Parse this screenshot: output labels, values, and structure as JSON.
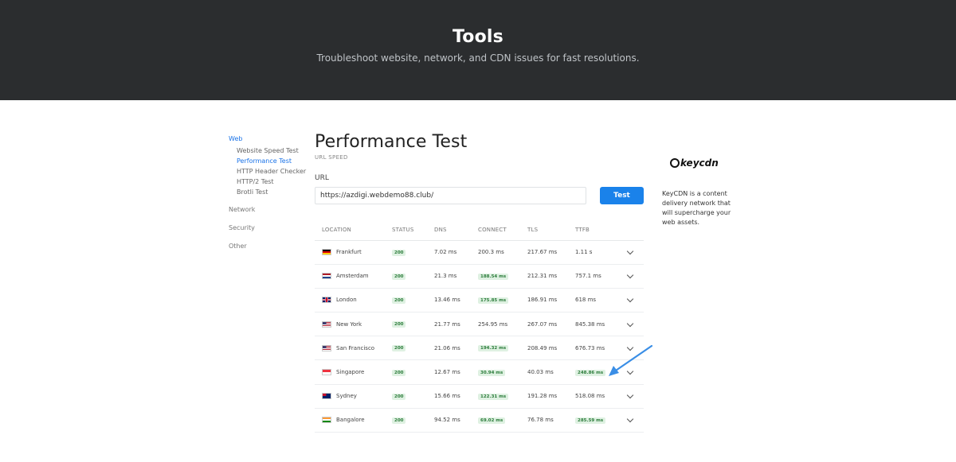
{
  "hero": {
    "title": "Tools",
    "subtitle": "Troubleshoot website, network, and CDN issues for fast resolutions."
  },
  "sidenav": {
    "web_label": "Web",
    "web_items": [
      {
        "label": "Website Speed Test",
        "active": false
      },
      {
        "label": "Performance Test",
        "active": true
      },
      {
        "label": "HTTP Header Checker",
        "active": false
      },
      {
        "label": "HTTP/2 Test",
        "active": false
      },
      {
        "label": "Brotli Test",
        "active": false
      }
    ],
    "network_label": "Network",
    "security_label": "Security",
    "other_label": "Other"
  },
  "main": {
    "title": "Performance Test",
    "subtitle": "URL SPEED",
    "url_label": "URL",
    "url_value": "https://azdigi.webdemo88.club/",
    "test_button": "Test"
  },
  "table": {
    "headers": [
      "LOCATION",
      "STATUS",
      "DNS",
      "CONNECT",
      "TLS",
      "TTFB"
    ],
    "rows": [
      {
        "location": "Frankfurt",
        "flag": "de",
        "status": "200",
        "dns": "7.02 ms",
        "connect": "200.3 ms",
        "connect_badge": false,
        "tls": "217.67 ms",
        "ttfb": "1.11 s",
        "ttfb_badge": false
      },
      {
        "location": "Amsterdam",
        "flag": "nl",
        "status": "200",
        "dns": "21.3 ms",
        "connect": "188.54 ms",
        "connect_badge": true,
        "tls": "212.31 ms",
        "ttfb": "757.1 ms",
        "ttfb_badge": false
      },
      {
        "location": "London",
        "flag": "gb",
        "status": "200",
        "dns": "13.46 ms",
        "connect": "175.85 ms",
        "connect_badge": true,
        "tls": "186.91 ms",
        "ttfb": "618 ms",
        "ttfb_badge": false
      },
      {
        "location": "New York",
        "flag": "us",
        "status": "200",
        "dns": "21.77 ms",
        "connect": "254.95 ms",
        "connect_badge": false,
        "tls": "267.07 ms",
        "ttfb": "845.38 ms",
        "ttfb_badge": false
      },
      {
        "location": "San Francisco",
        "flag": "us",
        "status": "200",
        "dns": "21.06 ms",
        "connect": "194.32 ms",
        "connect_badge": true,
        "tls": "208.49 ms",
        "ttfb": "676.73 ms",
        "ttfb_badge": false
      },
      {
        "location": "Singapore",
        "flag": "sg",
        "status": "200",
        "dns": "12.67 ms",
        "connect": "30.94 ms",
        "connect_badge": true,
        "tls": "40.03 ms",
        "ttfb": "248.86 ms",
        "ttfb_badge": true
      },
      {
        "location": "Sydney",
        "flag": "au",
        "status": "200",
        "dns": "15.66 ms",
        "connect": "122.31 ms",
        "connect_badge": true,
        "tls": "191.28 ms",
        "ttfb": "518.08 ms",
        "ttfb_badge": false
      },
      {
        "location": "Bangalore",
        "flag": "in",
        "status": "200",
        "dns": "94.52 ms",
        "connect": "69.02 ms",
        "connect_badge": true,
        "tls": "76.78 ms",
        "ttfb": "285.59 ms",
        "ttfb_badge": true
      }
    ]
  },
  "aside": {
    "logo_text": "keycdn",
    "description": "KeyCDN is a content delivery network that will supercharge your web assets."
  },
  "colors": {
    "hero_bg": "#2b2d2f",
    "accent": "#1a82ea",
    "badge_bg": "#dff1e2",
    "badge_text": "#2d7d3c",
    "annotation_arrow": "#3a8ee6"
  },
  "icons": {
    "expand": "chevron-down-icon",
    "annotation": "arrow-annotation-icon"
  }
}
